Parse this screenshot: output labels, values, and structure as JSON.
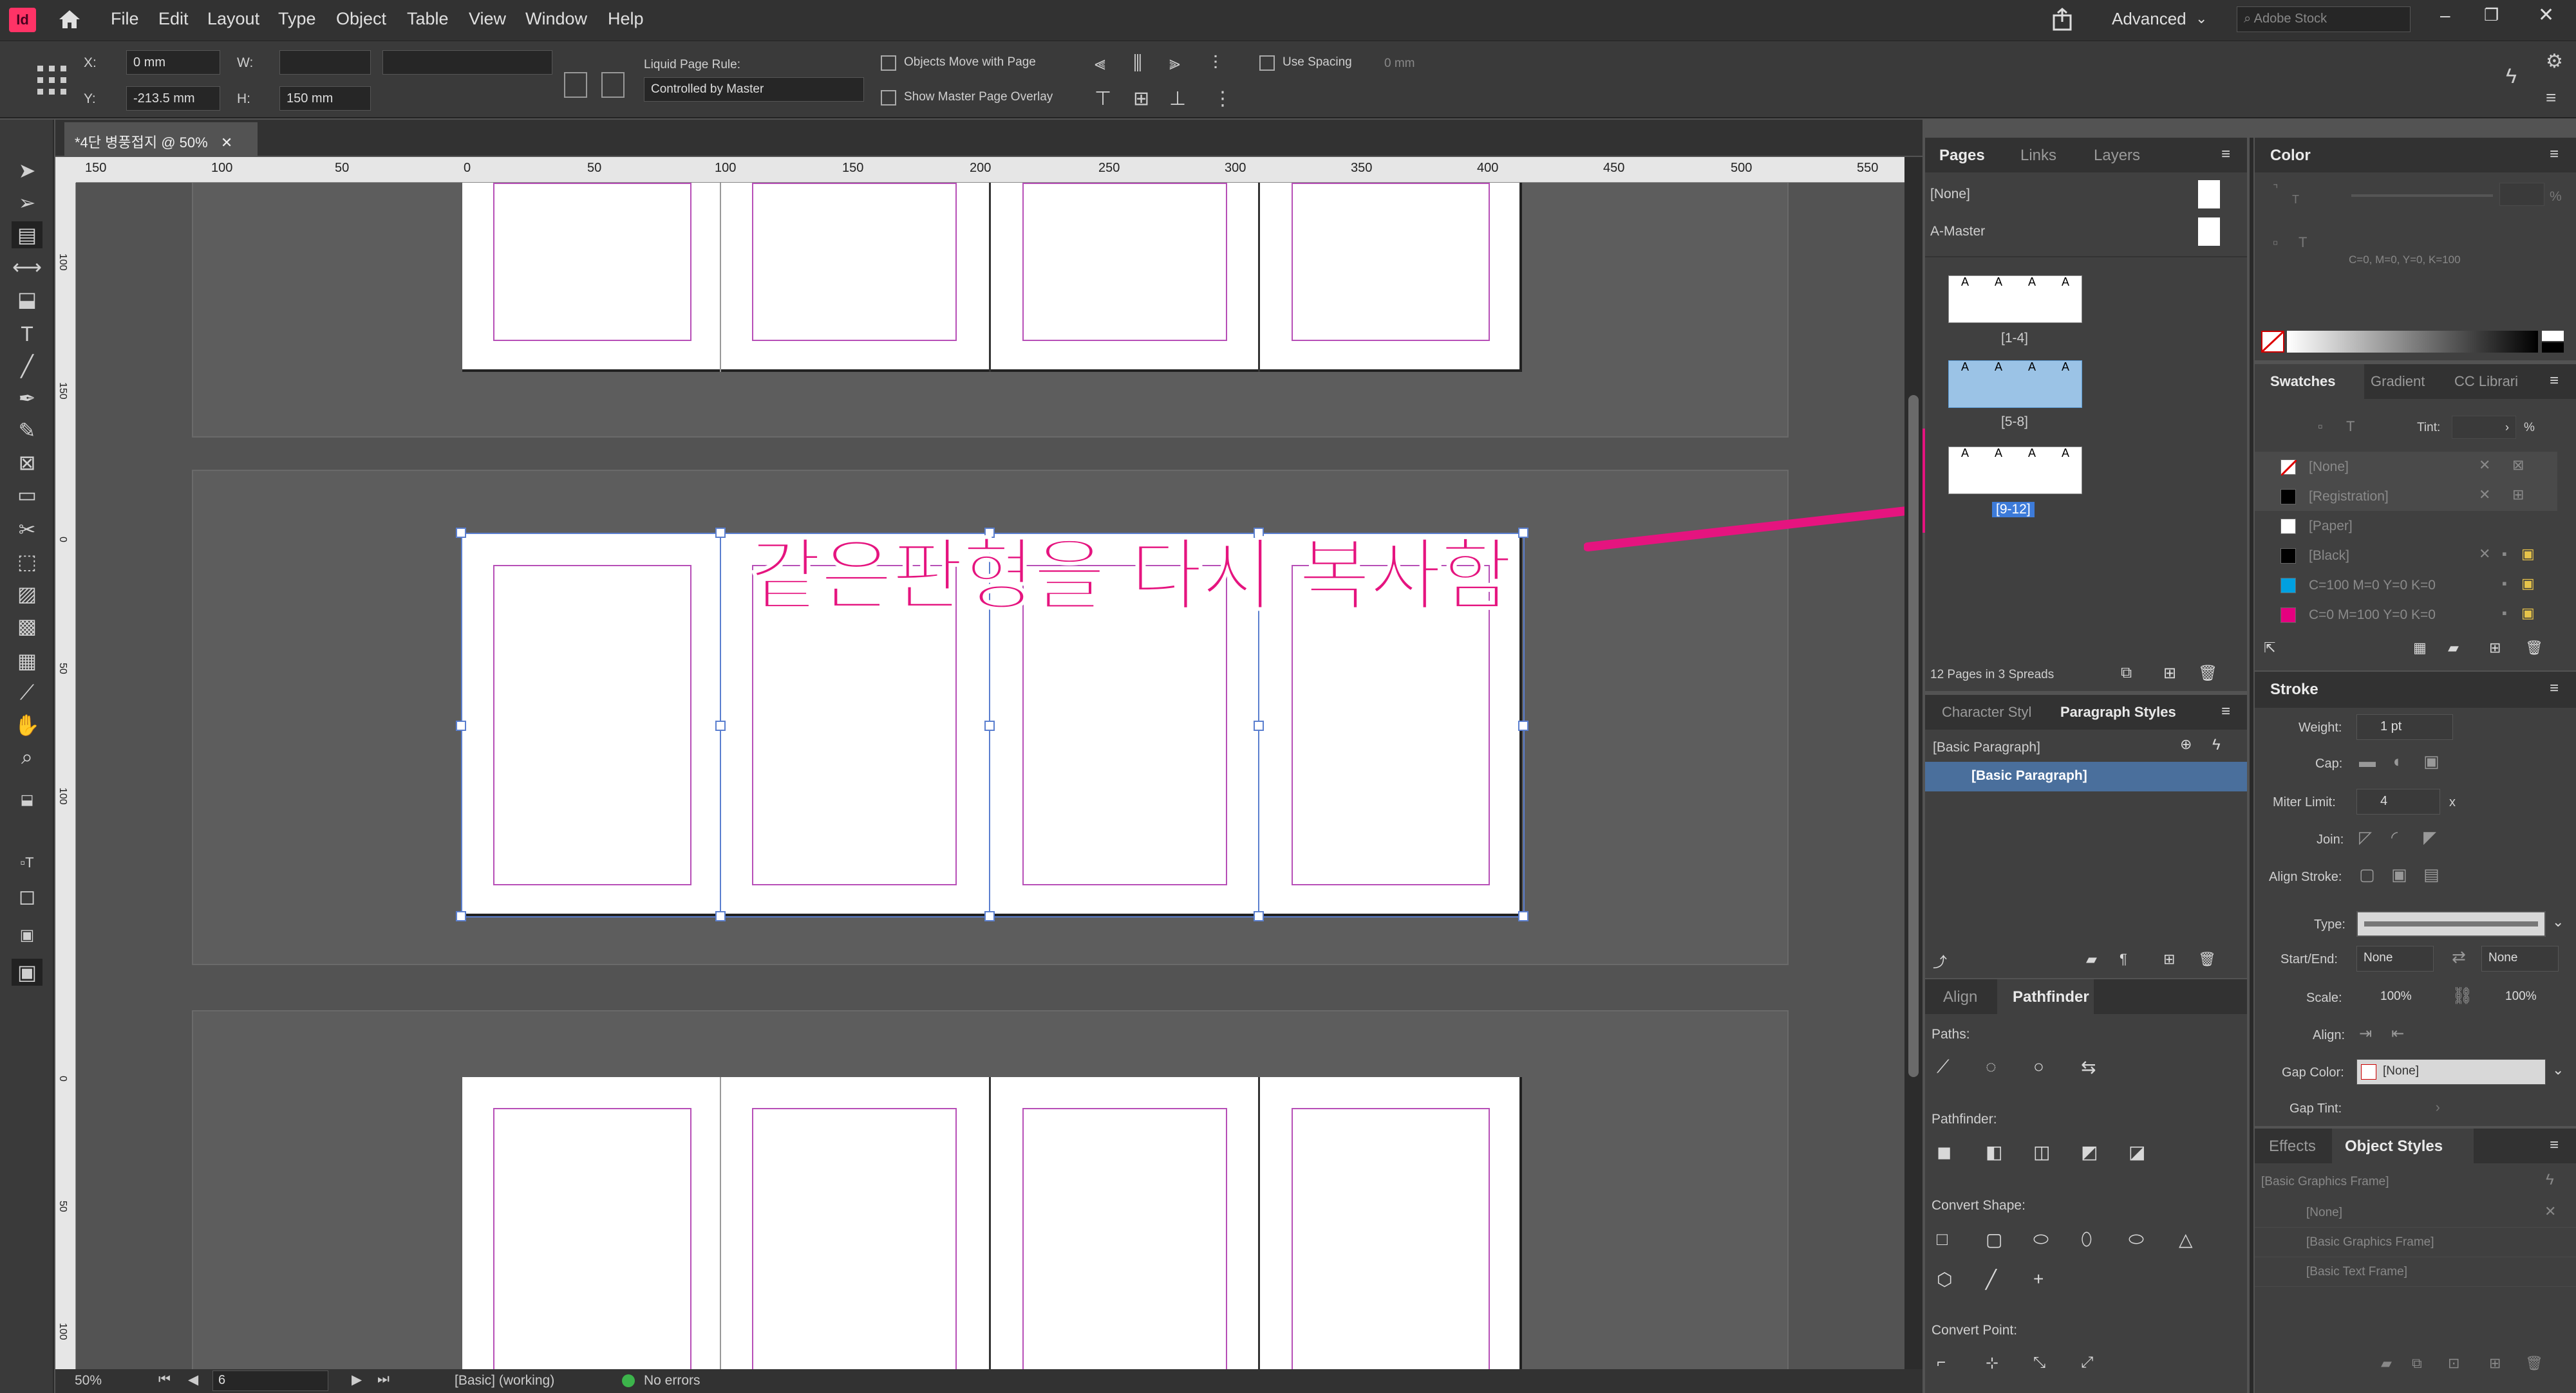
{
  "app": {
    "logo": "Id",
    "menu": [
      "File",
      "Edit",
      "Layout",
      "Type",
      "Object",
      "Table",
      "View",
      "Window",
      "Help"
    ],
    "workspace": "Advanced",
    "search_placeholder": "Adobe Stock"
  },
  "control": {
    "x_label": "X:",
    "x_value": "0 mm",
    "y_label": "Y:",
    "y_value": "-213.5 mm",
    "w_label": "W:",
    "h_label": "H:",
    "h_value": "150 mm",
    "liquid_label": "Liquid Page Rule:",
    "liquid_value": "Controlled by Master",
    "objects_move": "Objects Move with Page",
    "master_overlay": "Show Master Page Overlay",
    "use_spacing": "Use Spacing",
    "spacing_value": "0 mm"
  },
  "document": {
    "tab_title": "*4단 병풍접지 @ 50%",
    "ruler_h": [
      "150",
      "100",
      "50",
      "0",
      "50",
      "100",
      "150",
      "200",
      "250",
      "300",
      "350",
      "400",
      "450",
      "500",
      "550"
    ],
    "ruler_v": [
      "100",
      "150",
      "0",
      "50",
      "100",
      "0",
      "50",
      "100"
    ],
    "annotation": "같은판형을 다시 복사함",
    "annotation_color": "#e5147f"
  },
  "status": {
    "zoom": "50%",
    "page": "6",
    "preflight_profile": "[Basic] (working)",
    "errors": "No errors"
  },
  "pages_panel": {
    "tabs": [
      "Pages",
      "Links",
      "Layers"
    ],
    "none_label": "[None]",
    "master_label": "A-Master",
    "page_letter": "A",
    "spreads": [
      {
        "label": "[1-4]",
        "selected": false
      },
      {
        "label": "[5-8]",
        "selected": true
      },
      {
        "label": "[9-12]",
        "selected": false
      }
    ],
    "footer": "12 Pages in 3 Spreads"
  },
  "para_panel": {
    "tabs": [
      "Character Styl",
      "Paragraph Styles"
    ],
    "current": "[Basic Paragraph]",
    "items": [
      "[Basic Paragraph]"
    ]
  },
  "pathfinder_panel": {
    "tabs": [
      "Align",
      "Pathfinder"
    ],
    "paths": "Paths:",
    "pathfinder": "Pathfinder:",
    "convert_shape": "Convert Shape:",
    "convert_point": "Convert Point:"
  },
  "color_panel": {
    "title": "Color",
    "percent": "%",
    "cmyk": "C=0, M=0, Y=0, K=100"
  },
  "swatches_panel": {
    "tabs": [
      "Swatches",
      "Gradient",
      "CC Librari"
    ],
    "tint_label": "Tint:",
    "tint_unit": "%",
    "items": [
      {
        "name": "[None]",
        "color": "#ffffff"
      },
      {
        "name": "[Registration]",
        "color": "#000000"
      },
      {
        "name": "[Paper]",
        "color": "#ffffff"
      },
      {
        "name": "[Black]",
        "color": "#000000"
      },
      {
        "name": "C=100 M=0 Y=0 K=0",
        "color": "#00a0e0"
      },
      {
        "name": "C=0 M=100 Y=0 K=0",
        "color": "#e4007f"
      }
    ]
  },
  "stroke_panel": {
    "title": "Stroke",
    "weight_label": "Weight:",
    "weight_value": "1 pt",
    "cap_label": "Cap:",
    "miter_label": "Miter Limit:",
    "miter_value": "4",
    "miter_x": "x",
    "join_label": "Join:",
    "align_label": "Align Stroke:",
    "type_label": "Type:",
    "startend_label": "Start/End:",
    "start_value": "None",
    "end_value": "None",
    "scale_label": "Scale:",
    "scale_start": "100%",
    "scale_end": "100%",
    "align2_label": "Align:",
    "gapcolor_label": "Gap Color:",
    "gapcolor_value": "[None]",
    "gaptint_label": "Gap Tint:"
  },
  "objstyles_panel": {
    "tabs": [
      "Effects",
      "Object Styles"
    ],
    "current": "[Basic Graphics Frame]",
    "items": [
      "[None]",
      "[Basic Graphics Frame]",
      "[Basic Text Frame]"
    ]
  }
}
